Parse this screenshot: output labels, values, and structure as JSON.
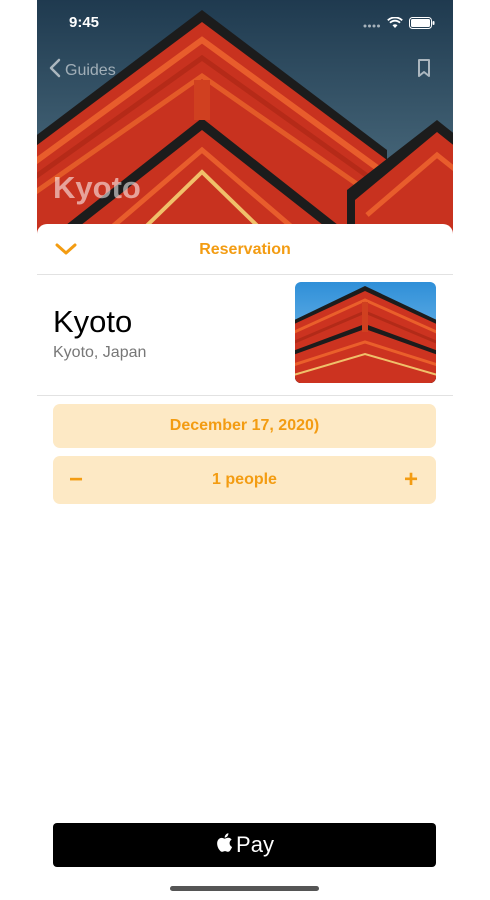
{
  "status_bar": {
    "time": "9:45"
  },
  "nav": {
    "back_label": "Guides"
  },
  "hero": {
    "title": "Kyoto"
  },
  "sheet": {
    "title": "Reservation"
  },
  "place": {
    "name": "Kyoto",
    "subtitle": "Kyoto, Japan"
  },
  "reservation": {
    "date": "December 17, 2020)",
    "people_label": "1 people",
    "minus_label": "−",
    "plus_label": "+"
  },
  "pay": {
    "label": "Pay"
  },
  "colors": {
    "accent": "#f39c12",
    "pill": "#fde9c5"
  },
  "icons": [
    "signal-icon",
    "wifi-icon",
    "battery-icon",
    "chevron-left-icon",
    "bookmark-icon",
    "chevron-down-icon",
    "apple-logo-icon"
  ]
}
